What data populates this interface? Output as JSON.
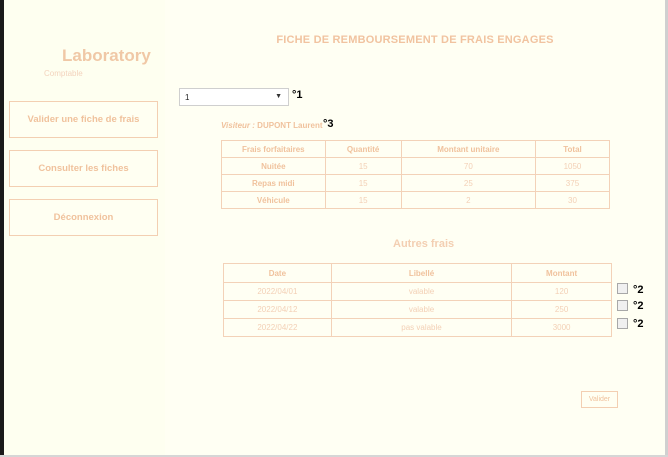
{
  "sidebar": {
    "brand_title": "Laboratory",
    "brand_subtitle": "Comptable",
    "items": [
      {
        "label": "Valider une fiche de frais"
      },
      {
        "label": "Consulter les fiches"
      },
      {
        "label": "Déconnexion"
      }
    ]
  },
  "main": {
    "title": "FICHE DE REMBOURSEMENT DE FRAIS ENGAGES",
    "select_value": "1",
    "visitor_label": "Visiteur :",
    "visitor_name": "DUPONT Laurent",
    "markers": {
      "select": "°1",
      "visitor": "°3",
      "row_check": "°2"
    },
    "forfait": {
      "headers": [
        "Frais forfaitaires",
        "Quantité",
        "Montant unitaire",
        "Total"
      ],
      "rows": [
        [
          "Nuitée",
          "15",
          "70",
          "1050"
        ],
        [
          "Repas midi",
          "15",
          "25",
          "375"
        ],
        [
          "Véhicule",
          "15",
          "2",
          "30"
        ]
      ]
    },
    "autres_title": "Autres frais",
    "autres": {
      "headers": [
        "Date",
        "Libellé",
        "Montant"
      ],
      "rows": [
        [
          "2022/04/01",
          "valable",
          "120"
        ],
        [
          "2022/04/12",
          "valable",
          "250"
        ],
        [
          "2022/04/22",
          "pas valable",
          "3000"
        ]
      ]
    },
    "valider_label": "Valider"
  },
  "colors": {
    "accent": "#f0c29d",
    "background": "#fffff0",
    "border": "#f3d2b8"
  }
}
